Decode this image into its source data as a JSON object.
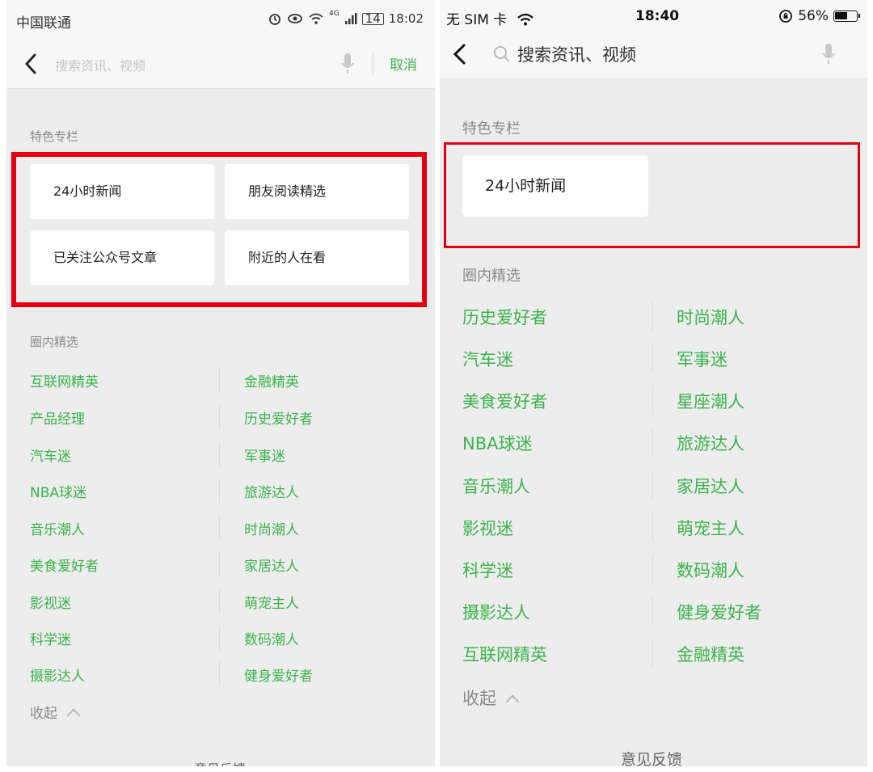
{
  "left": {
    "status": {
      "carrier": "中国联通",
      "signal_label": "4G",
      "battery": "14",
      "time": "18:02"
    },
    "search": {
      "placeholder": "搜索资讯、视频",
      "cancel_label": "取消"
    },
    "featured": {
      "title": "特色专栏",
      "cards": [
        "24小时新闻",
        "朋友阅读精选",
        "已关注公众号文章",
        "附近的人在看"
      ]
    },
    "circles": {
      "title": "圈内精选",
      "items": [
        "互联网精英",
        "金融精英",
        "产品经理",
        "历史爱好者",
        "汽车迷",
        "军事迷",
        "NBA球迷",
        "旅游达人",
        "音乐潮人",
        "时尚潮人",
        "美食爱好者",
        "家居达人",
        "影视迷",
        "萌宠主人",
        "科学迷",
        "数码潮人",
        "摄影达人",
        "健身爱好者"
      ],
      "collapse_label": "收起"
    },
    "feedback": "意见反馈"
  },
  "right": {
    "status": {
      "carrier": "无 SIM 卡",
      "time": "18:40",
      "battery": "56%"
    },
    "search": {
      "placeholder": "搜索资讯、视频"
    },
    "featured": {
      "title": "特色专栏",
      "cards": [
        "24小时新闻"
      ]
    },
    "circles": {
      "title": "圈内精选",
      "items": [
        "历史爱好者",
        "时尚潮人",
        "汽车迷",
        "军事迷",
        "美食爱好者",
        "星座潮人",
        "NBA球迷",
        "旅游达人",
        "音乐潮人",
        "家居达人",
        "影视迷",
        "萌宠主人",
        "科学迷",
        "数码潮人",
        "摄影达人",
        "健身爱好者",
        "互联网精英",
        "金融精英"
      ],
      "collapse_label": "收起"
    },
    "feedback": "意见反馈"
  },
  "colors": {
    "accent_green": "#3cb34d",
    "highlight_red": "#e60012",
    "page_bg": "#ededed"
  },
  "icons": [
    "back-chevron-icon",
    "mic-icon",
    "search-icon",
    "alarm-icon",
    "eye-icon",
    "wifi-icon",
    "signal-icon",
    "battery-icon",
    "lock-rotation-icon",
    "chevron-up-icon"
  ]
}
